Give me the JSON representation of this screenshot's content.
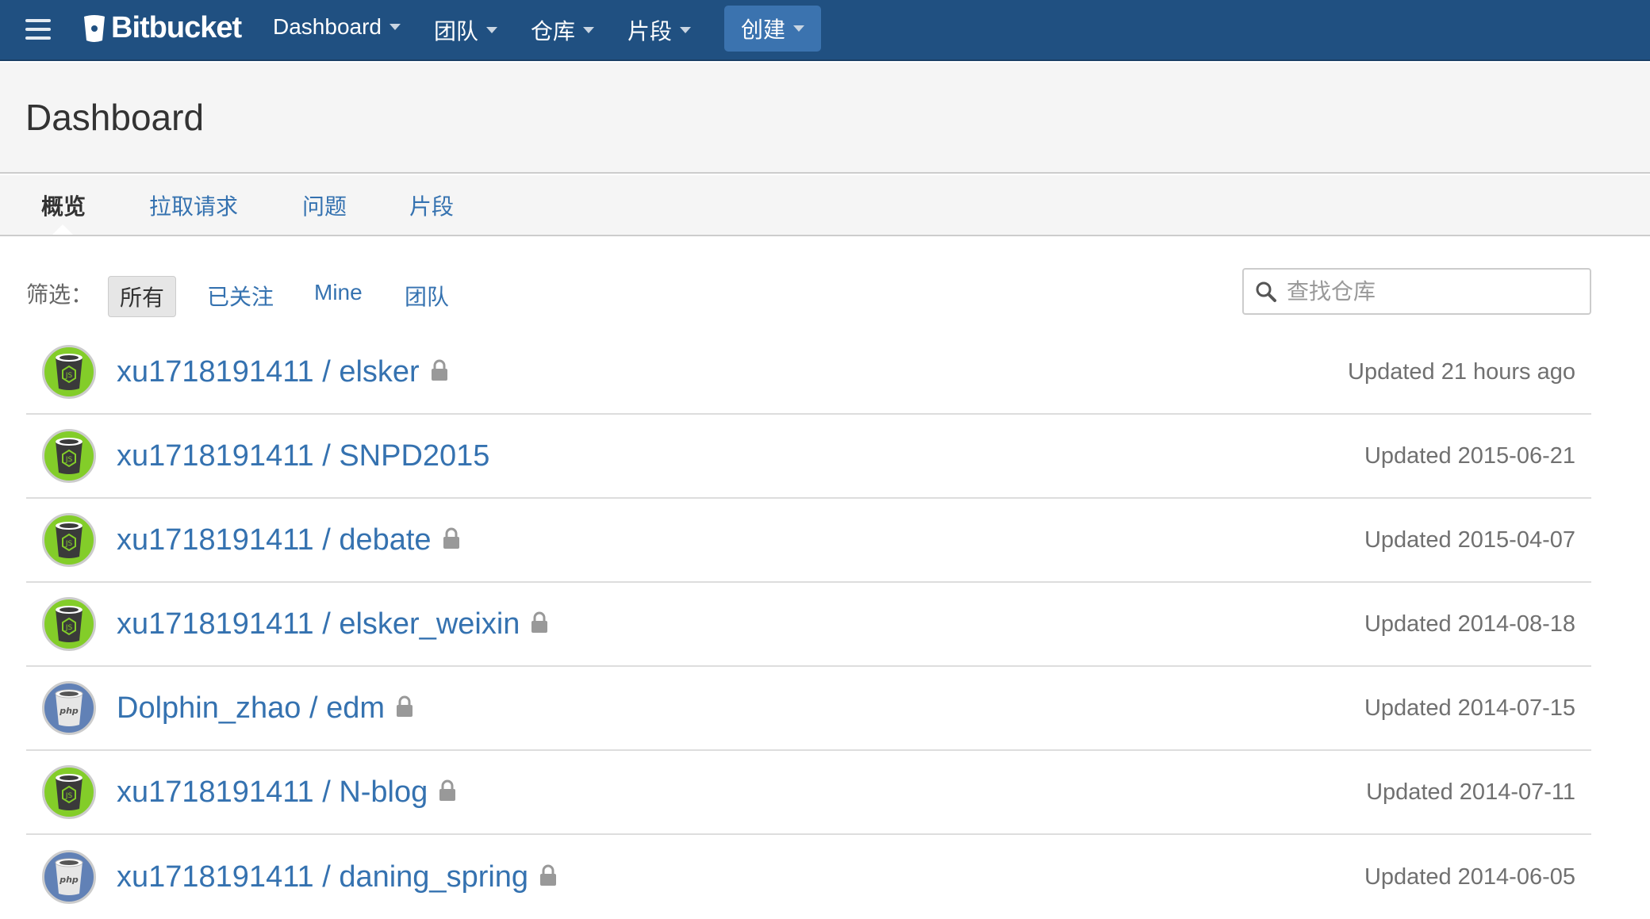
{
  "nav": {
    "brand": "Bitbucket",
    "items": [
      {
        "label": "Dashboard"
      },
      {
        "label": "团队"
      },
      {
        "label": "仓库"
      },
      {
        "label": "片段"
      }
    ],
    "create": "创建"
  },
  "header": {
    "title": "Dashboard"
  },
  "tabs": [
    {
      "label": "概览",
      "active": true
    },
    {
      "label": "拉取请求"
    },
    {
      "label": "问题"
    },
    {
      "label": "片段"
    }
  ],
  "filter": {
    "label": "筛选：",
    "options": [
      {
        "label": "所有",
        "active": true
      },
      {
        "label": "已关注"
      },
      {
        "label": "Mine"
      },
      {
        "label": "团队"
      }
    ]
  },
  "search": {
    "placeholder": "查找仓库",
    "value": ""
  },
  "repos": [
    {
      "name": "xu1718191411 / elsker",
      "private": true,
      "lang": "nodejs",
      "updated": "Updated 21 hours ago"
    },
    {
      "name": "xu1718191411 / SNPD2015",
      "private": false,
      "lang": "nodejs",
      "updated": "Updated 2015-06-21"
    },
    {
      "name": "xu1718191411 / debate",
      "private": true,
      "lang": "nodejs",
      "updated": "Updated 2015-04-07"
    },
    {
      "name": "xu1718191411 / elsker_weixin",
      "private": true,
      "lang": "nodejs",
      "updated": "Updated 2014-08-18"
    },
    {
      "name": "Dolphin_zhao / edm",
      "private": true,
      "lang": "php",
      "updated": "Updated 2014-07-15"
    },
    {
      "name": "xu1718191411 / N-blog",
      "private": true,
      "lang": "nodejs",
      "updated": "Updated 2014-07-11"
    },
    {
      "name": "xu1718191411 / daning_spring",
      "private": true,
      "lang": "php",
      "updated": "Updated 2014-06-05"
    }
  ],
  "colors": {
    "nav": "#205081",
    "link": "#3572b0",
    "create": "#3b73af"
  }
}
